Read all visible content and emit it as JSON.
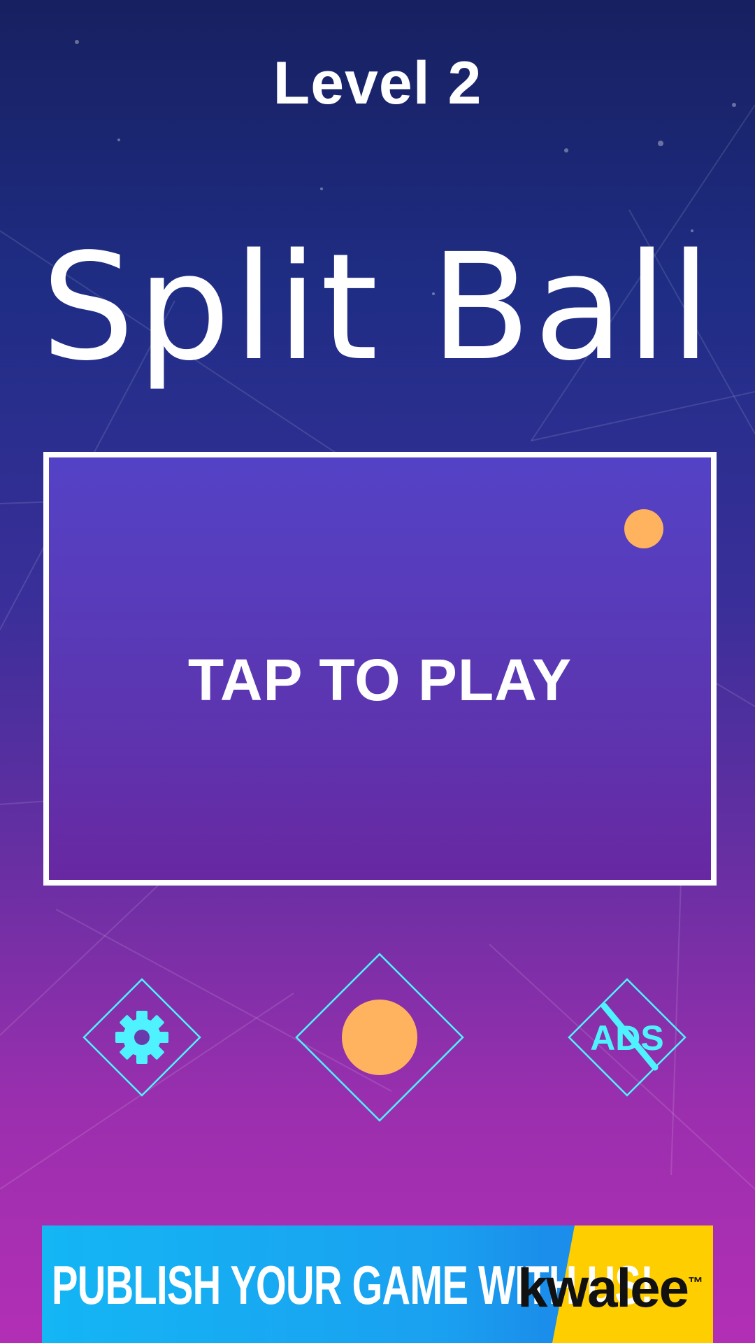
{
  "header": {
    "level_label": "Level 2"
  },
  "title": {
    "text": "Split Ball"
  },
  "play_panel": {
    "tap_label": "TAP TO PLAY",
    "ball_color": "#ffb35e"
  },
  "buttons": {
    "settings": {
      "icon": "gear-icon",
      "color": "#4ff3ff"
    },
    "ball_select": {
      "icon": "ball-icon",
      "ball_color": "#ffb35e",
      "color": "#4ff3ff"
    },
    "no_ads": {
      "icon": "no-ads-icon",
      "label": "ADS",
      "color": "#4ff3ff"
    }
  },
  "ad_banner": {
    "text": "PUBLISH YOUR GAME WITH US!",
    "brand": "kwalee",
    "brand_mark": "™"
  },
  "colors": {
    "accent": "#4ff3ff",
    "ball": "#ffb35e",
    "panel_border": "#ffffff",
    "ad_blue": "#1aa0f0",
    "ad_yellow": "#ffce00"
  }
}
